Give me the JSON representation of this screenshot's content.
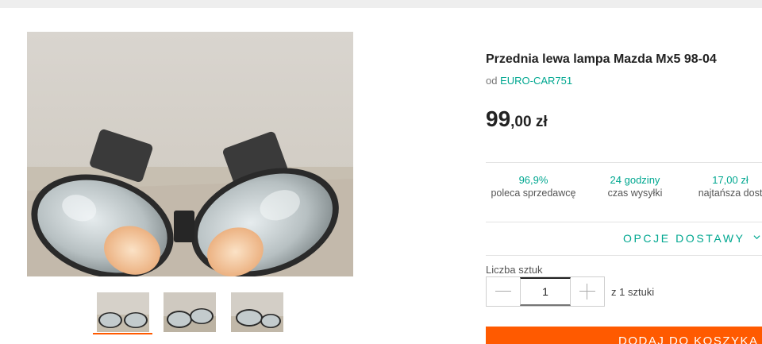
{
  "product": {
    "title": "Przednia lewa lampa Mazda Mx5 98-04",
    "seller_prefix": "od",
    "seller_name": "EURO-CAR751",
    "price_int": "99",
    "price_frac": ",00 zł"
  },
  "gallery": {
    "main_image": "headlights-photo",
    "thumbnails": [
      "headlights-photo-1",
      "headlights-photo-2",
      "headlights-photo-3"
    ],
    "active_index": 0
  },
  "stats": [
    {
      "value": "96,9%",
      "label": "poleca sprzedawcę"
    },
    {
      "value": "24 godziny",
      "label": "czas wysyłki"
    },
    {
      "value": "17,00 zł",
      "label": "najtańsza dost"
    }
  ],
  "delivery": {
    "options_label": "OPCJE DOSTAWY",
    "icon": "chevron-down-icon"
  },
  "quantity": {
    "label": "Liczba sztuk",
    "value": "1",
    "of_text": "z 1 sztuki"
  },
  "cart": {
    "button_label": "DODAJ DO KOSZYKA"
  },
  "colors": {
    "accent": "#00a790",
    "cta": "#ff5a00"
  }
}
